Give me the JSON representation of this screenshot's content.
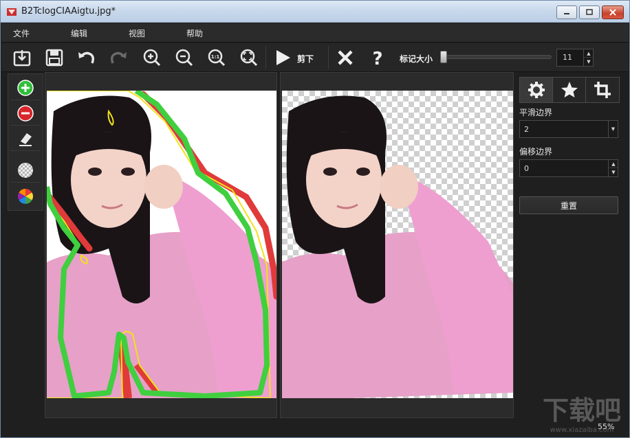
{
  "window": {
    "title": "B2TcIogCIAAigtu.jpg*"
  },
  "menu": {
    "items": [
      "文件",
      "编辑",
      "视图",
      "帮助"
    ]
  },
  "toolbar": {
    "cut_label": "剪下",
    "marker_size_label": "标记大小",
    "marker_size_value": "11",
    "marker_size_slider_level": 0.0
  },
  "side_panel": {
    "smooth_label": "平滑边界",
    "smooth_value": "2",
    "offset_label": "偏移边界",
    "offset_value": "0",
    "reset_label": "重置"
  },
  "status": {
    "zoom": "55%"
  },
  "watermark": {
    "text": "下载吧",
    "url": "www.xiazaiba.com"
  },
  "colors": {
    "keep_stroke": "#3fcf3f",
    "remove_stroke": "#e03a3a",
    "edge_stroke": "#f2e21a",
    "photo_bg_pink": "#e9a3cc"
  },
  "icons": {
    "open": "open-file-icon",
    "save": "save-icon",
    "undo": "undo-icon",
    "redo": "redo-icon",
    "zoom_in": "zoom-in-icon",
    "zoom_out": "zoom-out-icon",
    "actual_size": "actual-size-icon",
    "fit": "fit-window-icon",
    "cut": "play-icon",
    "clear": "close-x-icon",
    "help": "question-icon",
    "settings": "gear-icon",
    "effects": "star-icon",
    "crop": "crop-icon"
  }
}
